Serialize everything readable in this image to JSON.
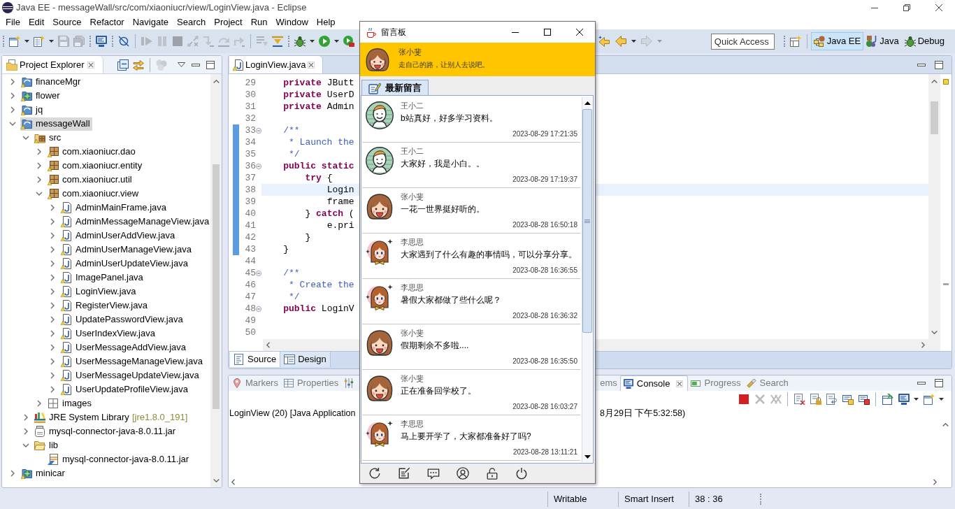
{
  "window": {
    "title": "Java EE - messageWall/src/com/xiaoniucr/view/LoginView.java - Eclipse"
  },
  "menu": [
    "File",
    "Edit",
    "Source",
    "Refactor",
    "Navigate",
    "Search",
    "Project",
    "Run",
    "Window",
    "Help"
  ],
  "toolbar": {
    "groups": [
      {
        "kind": "grip",
        "items": [
          {
            "kind": "new",
            "disabled": false
          },
          {
            "kind": "caret",
            "disabled": false
          },
          {
            "kind": "newfile",
            "disabled": false
          },
          {
            "kind": "caret",
            "disabled": false
          },
          {
            "kind": "save",
            "disabled": true
          },
          {
            "kind": "saveall",
            "disabled": true
          }
        ]
      },
      {
        "kind": "grip",
        "items": [
          {
            "kind": "monitor",
            "disabled": false
          }
        ]
      },
      {
        "kind": "grip",
        "items": [
          {
            "kind": "skip",
            "disabled": false
          }
        ]
      },
      {
        "kind": "line",
        "items": [
          {
            "kind": "resume",
            "disabled": true
          },
          {
            "kind": "suspend",
            "disabled": true
          },
          {
            "kind": "terminate",
            "disabled": true
          },
          {
            "kind": "disconnect",
            "disabled": true
          },
          {
            "kind": "stepinto",
            "disabled": true
          },
          {
            "kind": "stepover",
            "disabled": true
          },
          {
            "kind": "stepreturn",
            "disabled": true
          }
        ]
      },
      {
        "kind": "line",
        "items": [
          {
            "kind": "filter",
            "disabled": true
          },
          {
            "kind": "dropframe",
            "disabled": false
          }
        ]
      },
      {
        "kind": "grip",
        "items": [
          {
            "kind": "bug",
            "disabled": false
          },
          {
            "kind": "caret",
            "disabled": false
          },
          {
            "kind": "run",
            "disabled": false
          },
          {
            "kind": "caret",
            "disabled": false
          },
          {
            "kind": "runext",
            "disabled": false
          }
        ]
      }
    ],
    "navigation": [
      {
        "kind": "lastedit",
        "disabled": false
      },
      {
        "kind": "back",
        "disabled": false
      },
      {
        "kind": "caret",
        "disabled": false
      },
      {
        "kind": "forward",
        "disabled": true
      },
      {
        "kind": "caret",
        "disabled": true
      }
    ],
    "quick_access": {
      "placeholder": "Quick Access"
    },
    "perspectives": [
      {
        "kind": "javaee",
        "label": "Java EE",
        "selected": true
      },
      {
        "kind": "java",
        "label": "Java",
        "selected": false
      },
      {
        "kind": "debug",
        "label": "Debug",
        "selected": false
      }
    ]
  },
  "project_explorer": {
    "title": "Project Explorer",
    "toolbar": [
      {
        "kind": "plain",
        "items": [
          {
            "kind": "collapse",
            "disabled": false
          },
          {
            "kind": "link",
            "disabled": false
          }
        ]
      },
      {
        "kind": "line",
        "items": [
          {
            "kind": "filters",
            "disabled": true
          }
        ]
      }
    ],
    "tree": [
      {
        "label": "financeMgr",
        "kind": "project",
        "expanded": false,
        "selected": false
      },
      {
        "label": "flower",
        "kind": "webproject",
        "expanded": false,
        "selected": false
      },
      {
        "label": "jq",
        "kind": "project",
        "expanded": false,
        "selected": false
      },
      {
        "label": "messageWall",
        "kind": "project",
        "expanded": true,
        "selected": true,
        "children": [
          {
            "label": "src",
            "kind": "srcfolder",
            "expanded": true,
            "selected": false,
            "children": [
              {
                "label": "com.xiaoniucr.dao",
                "kind": "package",
                "expanded": false,
                "selected": false
              },
              {
                "label": "com.xiaoniucr.entity",
                "kind": "package",
                "expanded": false,
                "selected": false
              },
              {
                "label": "com.xiaoniucr.util",
                "kind": "package",
                "expanded": false,
                "selected": false
              },
              {
                "label": "com.xiaoniucr.view",
                "kind": "package",
                "expanded": true,
                "selected": false,
                "children": [
                  {
                    "label": "AdminMainFrame.java",
                    "kind": "javafile",
                    "expanded": false,
                    "selected": false
                  },
                  {
                    "label": "AdminMessageManageView.java",
                    "kind": "javafile",
                    "expanded": false,
                    "selected": false
                  },
                  {
                    "label": "AdminUserAddView.java",
                    "kind": "javafile",
                    "expanded": false,
                    "selected": false
                  },
                  {
                    "label": "AdminUserManageView.java",
                    "kind": "javafile",
                    "expanded": false,
                    "selected": false
                  },
                  {
                    "label": "AdminUserUpdateView.java",
                    "kind": "javafile",
                    "expanded": false,
                    "selected": false
                  },
                  {
                    "label": "ImagePanel.java",
                    "kind": "javafile",
                    "expanded": false,
                    "selected": false
                  },
                  {
                    "label": "LoginView.java",
                    "kind": "javafile",
                    "expanded": false,
                    "selected": false
                  },
                  {
                    "label": "RegisterView.java",
                    "kind": "javafile",
                    "expanded": false,
                    "selected": false
                  },
                  {
                    "label": "UpdatePasswordView.java",
                    "kind": "javafile",
                    "expanded": false,
                    "selected": false
                  },
                  {
                    "label": "UserIndexView.java",
                    "kind": "javafile",
                    "expanded": false,
                    "selected": false
                  },
                  {
                    "label": "UserMessageAddView.java",
                    "kind": "javafile",
                    "expanded": false,
                    "selected": false
                  },
                  {
                    "label": "UserMessageManageView.java",
                    "kind": "javafile",
                    "expanded": false,
                    "selected": false
                  },
                  {
                    "label": "UserMessageUpdateView.java",
                    "kind": "javafile",
                    "expanded": false,
                    "selected": false
                  },
                  {
                    "label": "UserUpdateProfileView.java",
                    "kind": "javafile",
                    "expanded": false,
                    "selected": false
                  }
                ]
              },
              {
                "label": "images",
                "kind": "emptypackage",
                "expanded": false,
                "selected": false
              }
            ]
          },
          {
            "label": "JRE System Library",
            "decoration": "[jre1.8.0_191]",
            "kind": "library",
            "expanded": false,
            "selected": false
          },
          {
            "label": "mysql-connector-java-8.0.11.jar",
            "kind": "jar",
            "expanded": false,
            "selected": false
          },
          {
            "label": "lib",
            "kind": "folder",
            "expanded": true,
            "selected": false,
            "children": [
              {
                "label": "mysql-connector-java-8.0.11.jar",
                "kind": "jarfile",
                "selected": false
              }
            ]
          }
        ]
      },
      {
        "label": "minicar",
        "kind": "webproject",
        "expanded": false,
        "selected": false
      }
    ]
  },
  "editor": {
    "tab": "LoginView.java",
    "lines": [
      {
        "number": "29",
        "kind": "code",
        "code": "    **private** JButt",
        "fold_marker": false,
        "range": false,
        "current": false
      },
      {
        "number": "30",
        "kind": "code",
        "code": "    **private** UserD",
        "fold_marker": false,
        "range": false,
        "current": false
      },
      {
        "number": "31",
        "kind": "code",
        "code": "    **private** Admin",
        "fold_marker": false,
        "range": false,
        "current": false
      },
      {
        "number": "32",
        "fold_marker": false,
        "range": false,
        "current": false
      },
      {
        "number": "33",
        "kind": "comment",
        "code": "    /**",
        "fold_marker": true,
        "range": true,
        "current": false
      },
      {
        "number": "34",
        "kind": "comment",
        "code": "     * Launch the",
        "fold_marker": false,
        "range": true,
        "current": false
      },
      {
        "number": "35",
        "kind": "comment",
        "code": "     */",
        "fold_marker": false,
        "range": true,
        "current": false
      },
      {
        "number": "36",
        "kind": "code",
        "code": "    **public** **static**",
        "fold_marker": true,
        "range": true,
        "current": false
      },
      {
        "number": "37",
        "kind": "code",
        "code": "        **try** {",
        "fold_marker": false,
        "range": true,
        "current": false
      },
      {
        "number": "38",
        "kind": "code",
        "code": "            Login",
        "fold_marker": false,
        "range": true,
        "current": true
      },
      {
        "number": "39",
        "kind": "code",
        "code": "            frame",
        "fold_marker": false,
        "range": true,
        "current": false
      },
      {
        "number": "40",
        "kind": "code",
        "code": "        } **catch** (",
        "fold_marker": false,
        "range": true,
        "current": false
      },
      {
        "number": "41",
        "kind": "code",
        "code": "            e.pri",
        "fold_marker": false,
        "range": true,
        "current": false
      },
      {
        "number": "42",
        "kind": "code",
        "code": "        }",
        "fold_marker": false,
        "range": true,
        "current": false
      },
      {
        "number": "43",
        "kind": "code",
        "code": "    }",
        "fold_marker": false,
        "range": true,
        "current": false
      },
      {
        "number": "44",
        "fold_marker": false,
        "range": false,
        "current": false
      },
      {
        "number": "45",
        "kind": "comment",
        "code": "    /**",
        "fold_marker": true,
        "range": false,
        "current": false
      },
      {
        "number": "46",
        "kind": "comment",
        "code": "     * Create the",
        "fold_marker": false,
        "range": false,
        "current": false
      },
      {
        "number": "47",
        "kind": "comment",
        "code": "     */",
        "fold_marker": false,
        "range": false,
        "current": false
      },
      {
        "number": "48",
        "kind": "code",
        "code": "    **public** LoginV",
        "fold_marker": true,
        "range": false,
        "current": false
      },
      {
        "number": "49",
        "fold_marker": false,
        "range": false,
        "current": false
      },
      {
        "number": "50",
        "fold_marker": false,
        "range": false,
        "current": false
      }
    ],
    "views": [
      {
        "kind": "source",
        "label": "Source",
        "selected": true
      },
      {
        "kind": "design",
        "label": "Design",
        "selected": false
      }
    ]
  },
  "console_panel": {
    "tabs": [
      {
        "kind": "markers",
        "label": "Markers",
        "selected": false
      },
      {
        "kind": "properties",
        "label": "Properties",
        "selected": false
      },
      {
        "kind": "servers",
        "selected": false
      },
      {
        "label": "ems",
        "selected": false
      },
      {
        "kind": "console",
        "label": "Console",
        "selected": true
      },
      {
        "kind": "progress",
        "label": "Progress",
        "selected": false
      },
      {
        "kind": "search",
        "label": "Search",
        "selected": false
      }
    ],
    "toolbar": [
      {
        "kind": "plain",
        "items": [
          {
            "kind": "terminate",
            "disabled": false
          },
          {
            "kind": "remove",
            "disabled": true
          },
          {
            "kind": "removeall",
            "disabled": true
          }
        ]
      },
      {
        "kind": "line",
        "items": [
          {
            "kind": "clear",
            "disabled": false
          },
          {
            "kind": "scrolllock",
            "disabled": false
          },
          {
            "kind": "wrap",
            "disabled": false
          },
          {
            "kind": "stdout",
            "disabled": false
          },
          {
            "kind": "stderr",
            "disabled": false
          }
        ]
      },
      {
        "kind": "line",
        "items": [
          {
            "kind": "pin",
            "disabled": false
          },
          {
            "kind": "display",
            "disabled": false
          },
          {
            "kind": "caret",
            "disabled": false
          },
          {
            "kind": "open",
            "disabled": false
          },
          {
            "kind": "caret",
            "disabled": false
          }
        ]
      }
    ],
    "process": [
      "LoginView (20) [Java Application",
      "8月29日 下午5:32:58)"
    ]
  },
  "status_bar": [
    "Writable",
    "Smart Insert",
    "38 : 36"
  ],
  "message_board": {
    "title": "留言板",
    "user": {
      "kind": "girl",
      "name": "张小斐",
      "motto": "走自己的路，让别人去说吧。"
    },
    "tabs": [
      {
        "label": "最新留言",
        "selected": true
      }
    ],
    "messages": [
      {
        "kind": "boy",
        "author": "王小二",
        "text": "b站真好，好多学习资料。",
        "time": "2023-08-29 17:21:35"
      },
      {
        "kind": "boy",
        "author": "王小二",
        "text": "大家好，我是小白。。",
        "time": "2023-08-29 17:19:37"
      },
      {
        "kind": "girl",
        "author": "张小斐",
        "text": "一花一世界挺好听的。",
        "time": "2023-08-28 16:50:18"
      },
      {
        "kind": "lady",
        "author": "李思思",
        "text": "大家遇到了什么有趣的事情吗，可以分享分享。",
        "time": "2023-08-28 16:36:55"
      },
      {
        "kind": "lady",
        "author": "李思思",
        "text": "暑假大家都做了些什么呢？",
        "time": "2023-08-28 16:36:32"
      },
      {
        "kind": "girl",
        "author": "张小斐",
        "text": "假期剩余不多啦....",
        "time": "2023-08-28 16:35:50"
      },
      {
        "kind": "girl",
        "author": "张小斐",
        "text": "正在准备回学校了。",
        "time": "2023-08-28 16:03:27"
      },
      {
        "kind": "lady",
        "author": "李思思",
        "text": "马上要开学了，大家都准备好了吗?",
        "time": "2023-08-28 13:11:21"
      }
    ]
  }
}
